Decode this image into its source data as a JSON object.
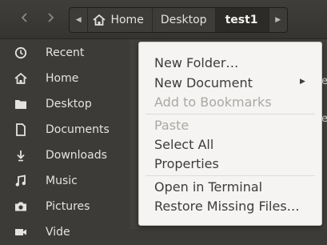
{
  "header": {
    "back_icon": "chevron-left-icon",
    "forward_icon": "chevron-right-icon",
    "breadcrumbs": [
      {
        "label": "Home",
        "icon": "home-icon"
      },
      {
        "label": "Desktop"
      },
      {
        "label": "test1",
        "active": true
      }
    ]
  },
  "sidebar": {
    "items": [
      {
        "label": "Recent",
        "icon": "clock-icon"
      },
      {
        "label": "Home",
        "icon": "home-icon"
      },
      {
        "label": "Desktop",
        "icon": "folder-icon"
      },
      {
        "label": "Documents",
        "icon": "document-icon"
      },
      {
        "label": "Downloads",
        "icon": "download-icon"
      },
      {
        "label": "Music",
        "icon": "music-icon"
      },
      {
        "label": "Pictures",
        "icon": "camera-icon"
      },
      {
        "label": "Vide",
        "icon": "video-icon"
      }
    ]
  },
  "context_menu": {
    "new_folder": "New Folder…",
    "new_document": "New Document",
    "add_bookmarks": "Add to Bookmarks",
    "paste": "Paste",
    "select_all": "Select All",
    "properties": "Properties",
    "open_terminal": "Open in Terminal",
    "restore_files": "Restore Missing Files…"
  },
  "colors": {
    "window_bg": "#3c3b37",
    "menu_bg": "#f5f4f2",
    "menu_text": "#3c3c3c",
    "disabled_text": "#a9a8a4"
  }
}
